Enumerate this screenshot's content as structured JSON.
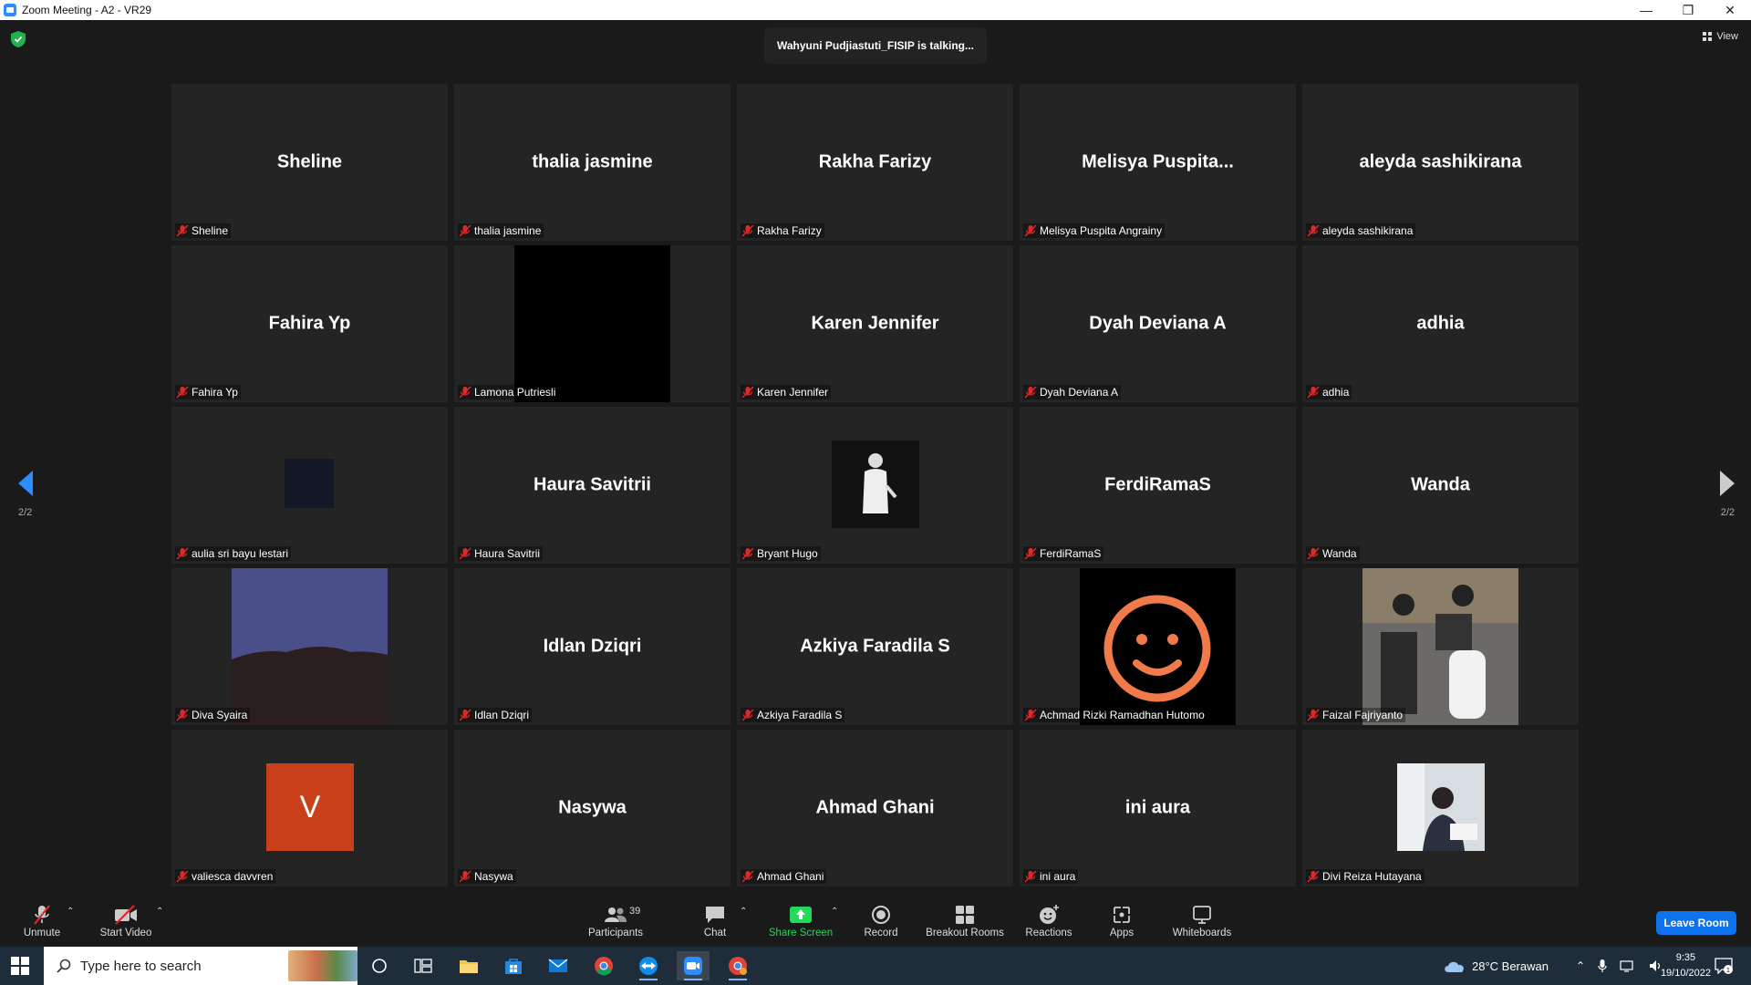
{
  "window": {
    "title": "Zoom Meeting - A2 - VR29"
  },
  "meeting": {
    "talking_indicator": "Wahyuni Pudjiastuti_FISIP is talking...",
    "view_label": "View",
    "page_left": "2/2",
    "page_right": "2/2"
  },
  "participants": [
    {
      "display": "Sheline",
      "name": "Sheline",
      "media": "none"
    },
    {
      "display": "thalia jasmine",
      "name": "thalia jasmine",
      "media": "none"
    },
    {
      "display": "Rakha Farizy",
      "name": "Rakha Farizy",
      "media": "none"
    },
    {
      "display": "Melisya  Puspita...",
      "name": "Melisya Puspita Angrainy",
      "media": "none"
    },
    {
      "display": "aleyda sashikirana",
      "name": "aleyda sashikirana",
      "media": "none"
    },
    {
      "display": "Fahira Yp",
      "name": "Fahira Yp",
      "media": "none"
    },
    {
      "display": "",
      "name": "Lamona Putriesli",
      "media": "black-video"
    },
    {
      "display": "Karen Jennifer",
      "name": "Karen Jennifer",
      "media": "none"
    },
    {
      "display": "Dyah Deviana A",
      "name": "Dyah Deviana A",
      "media": "none"
    },
    {
      "display": "adhia",
      "name": "adhia",
      "media": "none"
    },
    {
      "display": "",
      "name": "aulia sri bayu lestari",
      "media": "dark-avatar"
    },
    {
      "display": "Haura Savitrii",
      "name": "Haura Savitrii",
      "media": "none"
    },
    {
      "display": "",
      "name": "Bryant Hugo",
      "media": "person-avatar"
    },
    {
      "display": "FerdiRamaS",
      "name": "FerdiRamaS",
      "media": "none"
    },
    {
      "display": "Wanda",
      "name": "Wanda",
      "media": "none"
    },
    {
      "display": "",
      "name": "Diva Syaira",
      "media": "landscape-photo"
    },
    {
      "display": "Idlan Dziqri",
      "name": "Idlan Dziqri",
      "media": "none"
    },
    {
      "display": "Azkiya Faradila S",
      "name": "Azkiya Faradila S",
      "media": "none"
    },
    {
      "display": "",
      "name": "Achmad Rizki Ramadhan Hutomo",
      "media": "smiley-photo"
    },
    {
      "display": "",
      "name": "Faizal Fajriyanto",
      "media": "street-photo"
    },
    {
      "display": "",
      "name": "valiesca davvren",
      "media": "letter-avatar",
      "avatar_letter": "V",
      "avatar_color": "#c9401a"
    },
    {
      "display": "Nasywa",
      "name": "Nasywa",
      "media": "none"
    },
    {
      "display": "Ahmad Ghani",
      "name": "Ahmad Ghani",
      "media": "none"
    },
    {
      "display": "ini aura",
      "name": "ini aura",
      "media": "none"
    },
    {
      "display": "",
      "name": "Divi Reiza Hutayana",
      "media": "portrait-photo"
    }
  ],
  "toolbar": {
    "unmute": "Unmute",
    "start_video": "Start Video",
    "participants": "Participants",
    "participants_count": "39",
    "chat": "Chat",
    "share_screen": "Share Screen",
    "record": "Record",
    "breakout_rooms": "Breakout Rooms",
    "reactions": "Reactions",
    "apps": "Apps",
    "whiteboards": "Whiteboards",
    "leave_room": "Leave Room"
  },
  "taskbar": {
    "search_placeholder": "Type here to search",
    "weather": "28°C  Berawan",
    "time": "9:35",
    "date": "19/10/2022",
    "notification_count": "1"
  },
  "colors": {
    "accent": "#0e72ed",
    "share_green": "#23d959",
    "muted_red": "#e02828"
  }
}
